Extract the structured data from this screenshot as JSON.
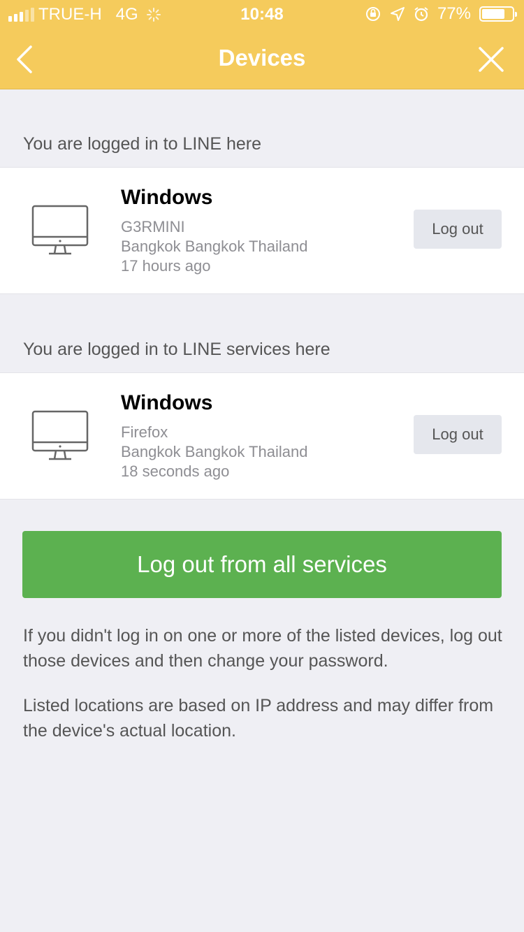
{
  "status_bar": {
    "carrier": "TRUE-H",
    "network": "4G",
    "time": "10:48",
    "battery": "77%"
  },
  "nav": {
    "title": "Devices"
  },
  "sections": [
    {
      "label": "You are logged in to LINE here",
      "device": {
        "name": "Windows",
        "detail": "G3RMINI",
        "location": "Bangkok Bangkok Thailand",
        "time": "17 hours ago",
        "logout_label": "Log out"
      }
    },
    {
      "label": "You are logged in to LINE services here",
      "device": {
        "name": "Windows",
        "detail": "Firefox",
        "location": "Bangkok Bangkok Thailand",
        "time": "18 seconds ago",
        "logout_label": "Log out"
      }
    }
  ],
  "logout_all_label": "Log out from all services",
  "notes": [
    "If you didn't log in on one or more of the listed devices, log out those devices and then change your password.",
    "Listed locations are based on IP address and may differ from the device's actual location."
  ],
  "colors": {
    "header": "#f5cb5c",
    "primary_button": "#5cb150",
    "background": "#efeff4"
  },
  "icons": {
    "back": "chevron-left-icon",
    "close": "close-icon",
    "device": "desktop-monitor-icon"
  }
}
